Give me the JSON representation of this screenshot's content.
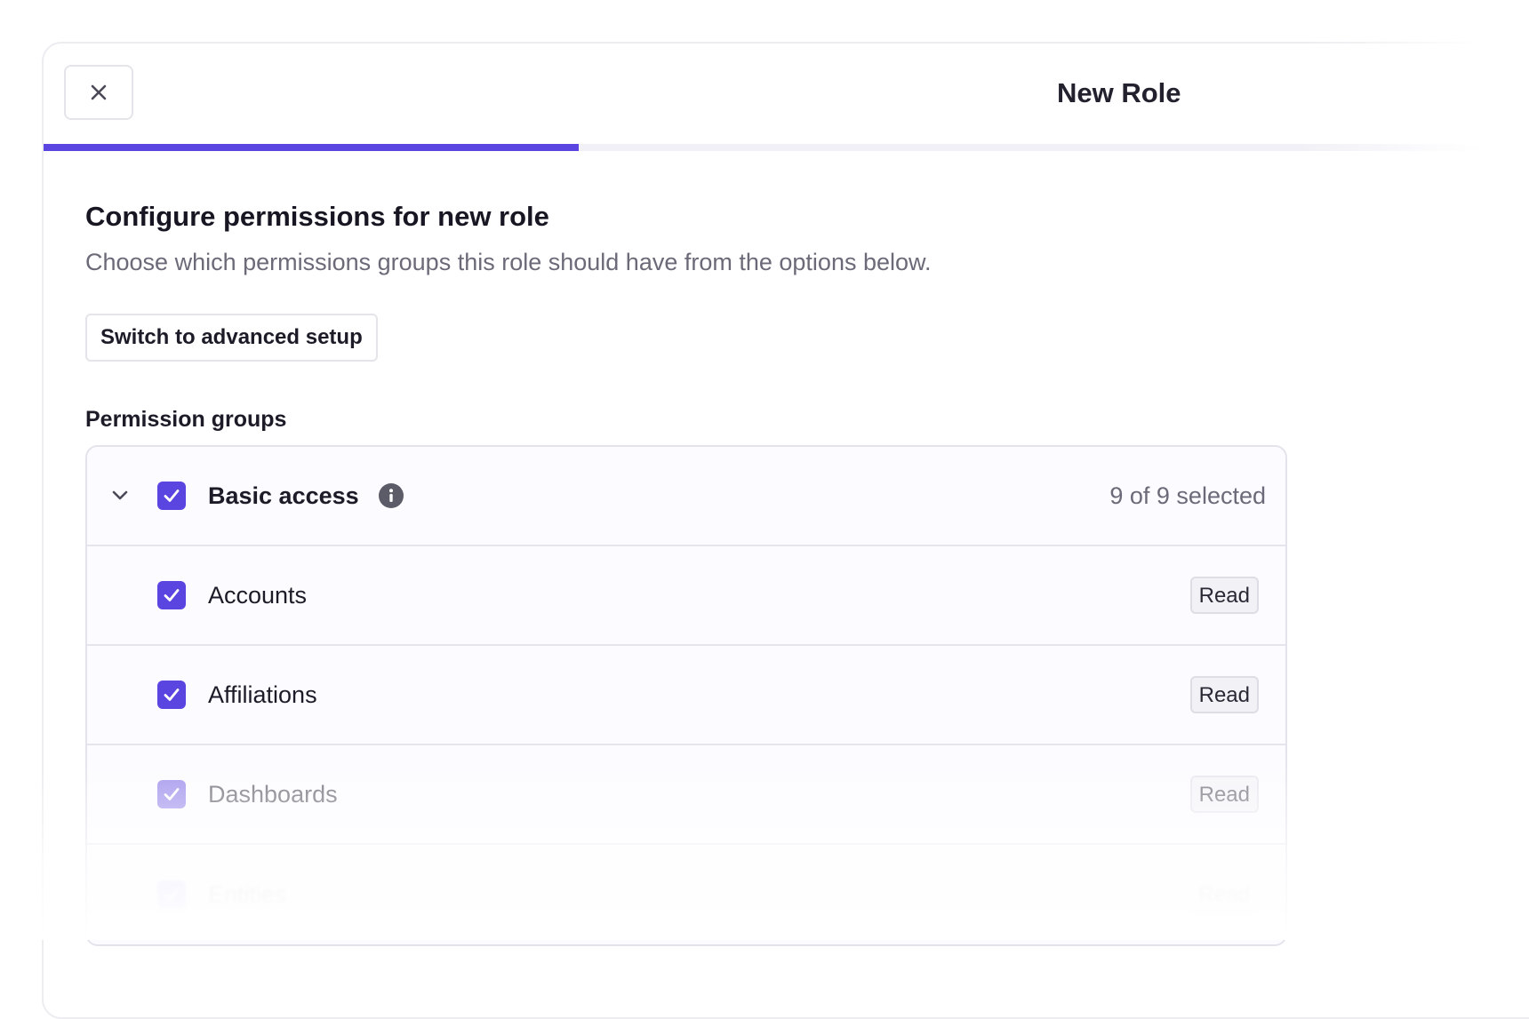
{
  "header": {
    "title": "New Role",
    "progress_fraction": 0.35
  },
  "colors": {
    "accent": "#5b45e0",
    "muted_text": "#6b6a78"
  },
  "main": {
    "heading": "Configure permissions for new role",
    "description": "Choose which permissions groups this role should have from the options below.",
    "advanced_button_label": "Switch to advanced setup",
    "groups_label": "Permission groups"
  },
  "permission_group": {
    "name": "Basic access",
    "checked": true,
    "expanded": true,
    "selected_count": "9 of 9 selected",
    "items": [
      {
        "label": "Accounts",
        "access": "Read",
        "checked": true
      },
      {
        "label": "Affiliations",
        "access": "Read",
        "checked": true
      },
      {
        "label": "Dashboards",
        "access": "Read",
        "checked": true
      },
      {
        "label": "Entities",
        "access": "Read",
        "checked": true
      }
    ]
  }
}
